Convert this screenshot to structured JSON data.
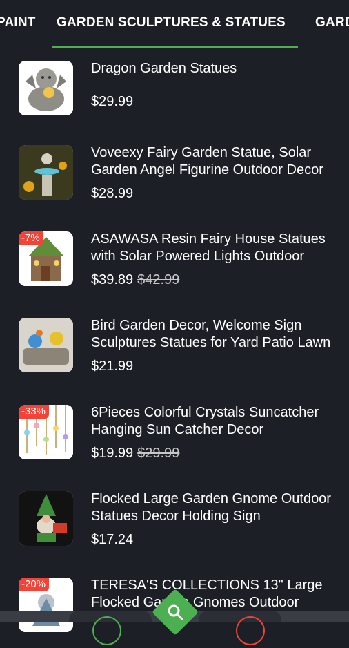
{
  "tabs": {
    "left": "PAINT",
    "active": "GARDEN SCULPTURES & STATUES",
    "right": "GARDEN"
  },
  "products": [
    {
      "title": "Dragon Garden Statues",
      "price": "$29.99",
      "old_price": "",
      "badge": ""
    },
    {
      "title": "Voveexy Fairy Garden Statue, Solar Garden Angel Figurine Outdoor Decor",
      "price": "$28.99",
      "old_price": "",
      "badge": ""
    },
    {
      "title": "ASAWASA Resin Fairy House Statues with Solar Powered Lights Outdoor",
      "price": "$39.89",
      "old_price": "$42.99",
      "badge": "-7%"
    },
    {
      "title": "Bird Garden Decor, Welcome Sign Sculptures Statues for Yard Patio Lawn",
      "price": "$21.99",
      "old_price": "",
      "badge": ""
    },
    {
      "title": "6Pieces Colorful Crystals Suncatcher Hanging Sun Catcher Decor",
      "price": "$19.99",
      "old_price": "$29.99",
      "badge": "-33%"
    },
    {
      "title": "Flocked Large Garden Gnome Outdoor Statues Decor Holding Sign",
      "price": "$17.24",
      "old_price": "",
      "badge": ""
    },
    {
      "title": "TERESA'S COLLECTIONS 13\" Large Flocked Garden Gnomes Outdoor",
      "price": "",
      "old_price": "",
      "badge": "-20%"
    }
  ],
  "icons": {
    "search": "search-icon"
  },
  "colors": {
    "background": "#1c1f26",
    "accent": "#4caf50",
    "badge": "#f44336"
  }
}
